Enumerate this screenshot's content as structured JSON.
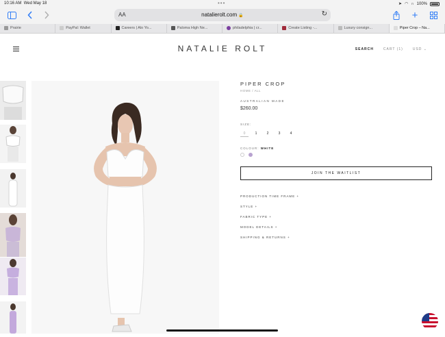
{
  "status_bar": {
    "time": "10:16 AM",
    "date": "Wed May 18",
    "battery": "100%"
  },
  "browser": {
    "text_size_label": "AA",
    "url": "natalierolt.com",
    "tabs": [
      {
        "label": "Prairie"
      },
      {
        "label": "PayPal: Wallet"
      },
      {
        "label": "Careers | Alo Yo..."
      },
      {
        "label": "Paloma High Ne..."
      },
      {
        "label": "philadelphia | cr..."
      },
      {
        "label": "Create Listing -..."
      },
      {
        "label": "Luxury consign..."
      },
      {
        "label": "Piper Crop – Na..."
      }
    ]
  },
  "site": {
    "logo": "NATALIE ROLT",
    "nav": {
      "search": "SEARCH",
      "cart": "CART (1)",
      "currency": "USD"
    }
  },
  "product": {
    "title": "PIPER CROP",
    "breadcrumb": "HOME / ALL",
    "origin": "AUSTRALIAN MADE",
    "price": "$260.00",
    "size_label": "SIZE:",
    "sizes": [
      "0",
      "1",
      "2",
      "3",
      "4"
    ],
    "selected_size": "0",
    "colour_label": "COLOUR:",
    "colour_value": "WHITE",
    "colours": [
      "white",
      "purple"
    ],
    "cta": "JOIN THE WAITLIST",
    "accordions": [
      "PRODUCTION TIME FRAME +",
      "STYLE +",
      "FABRIC TYPE +",
      "MODEL DETAILS +",
      "SHIPPING & RETURNS +"
    ]
  },
  "colors": {
    "accent_blue": "#2f7cf6",
    "swatch_purple": "#b8a2d0"
  }
}
